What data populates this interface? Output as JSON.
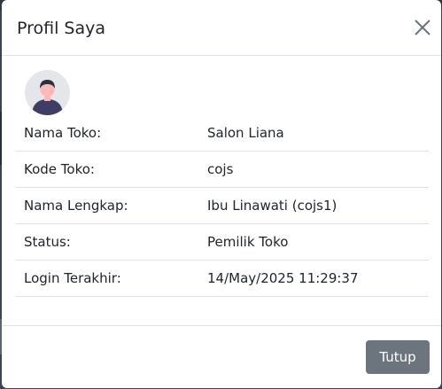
{
  "modal": {
    "title": "Profil Saya",
    "close_icon": "close-icon",
    "avatar_icon": "user-avatar-icon",
    "rows": [
      {
        "label": "Nama Toko:",
        "value": "Salon Liana"
      },
      {
        "label": "Kode Toko:",
        "value": "cojs"
      },
      {
        "label": "Nama Lengkap:",
        "value": "Ibu Linawati (cojs1)"
      },
      {
        "label": "Status:",
        "value": "Pemilik Toko"
      },
      {
        "label": "Login Terakhir:",
        "value": "14/May/2025 11:29:37"
      }
    ],
    "close_button_label": "Tutup"
  },
  "colors": {
    "button_bg": "#6c757d",
    "divider": "#dee2e6",
    "text": "#212529",
    "avatar_bg": "#e4e6ea",
    "avatar_shirt": "#3f3d63",
    "avatar_hair": "#2f2e41",
    "avatar_skin": "#ffb8b8"
  }
}
